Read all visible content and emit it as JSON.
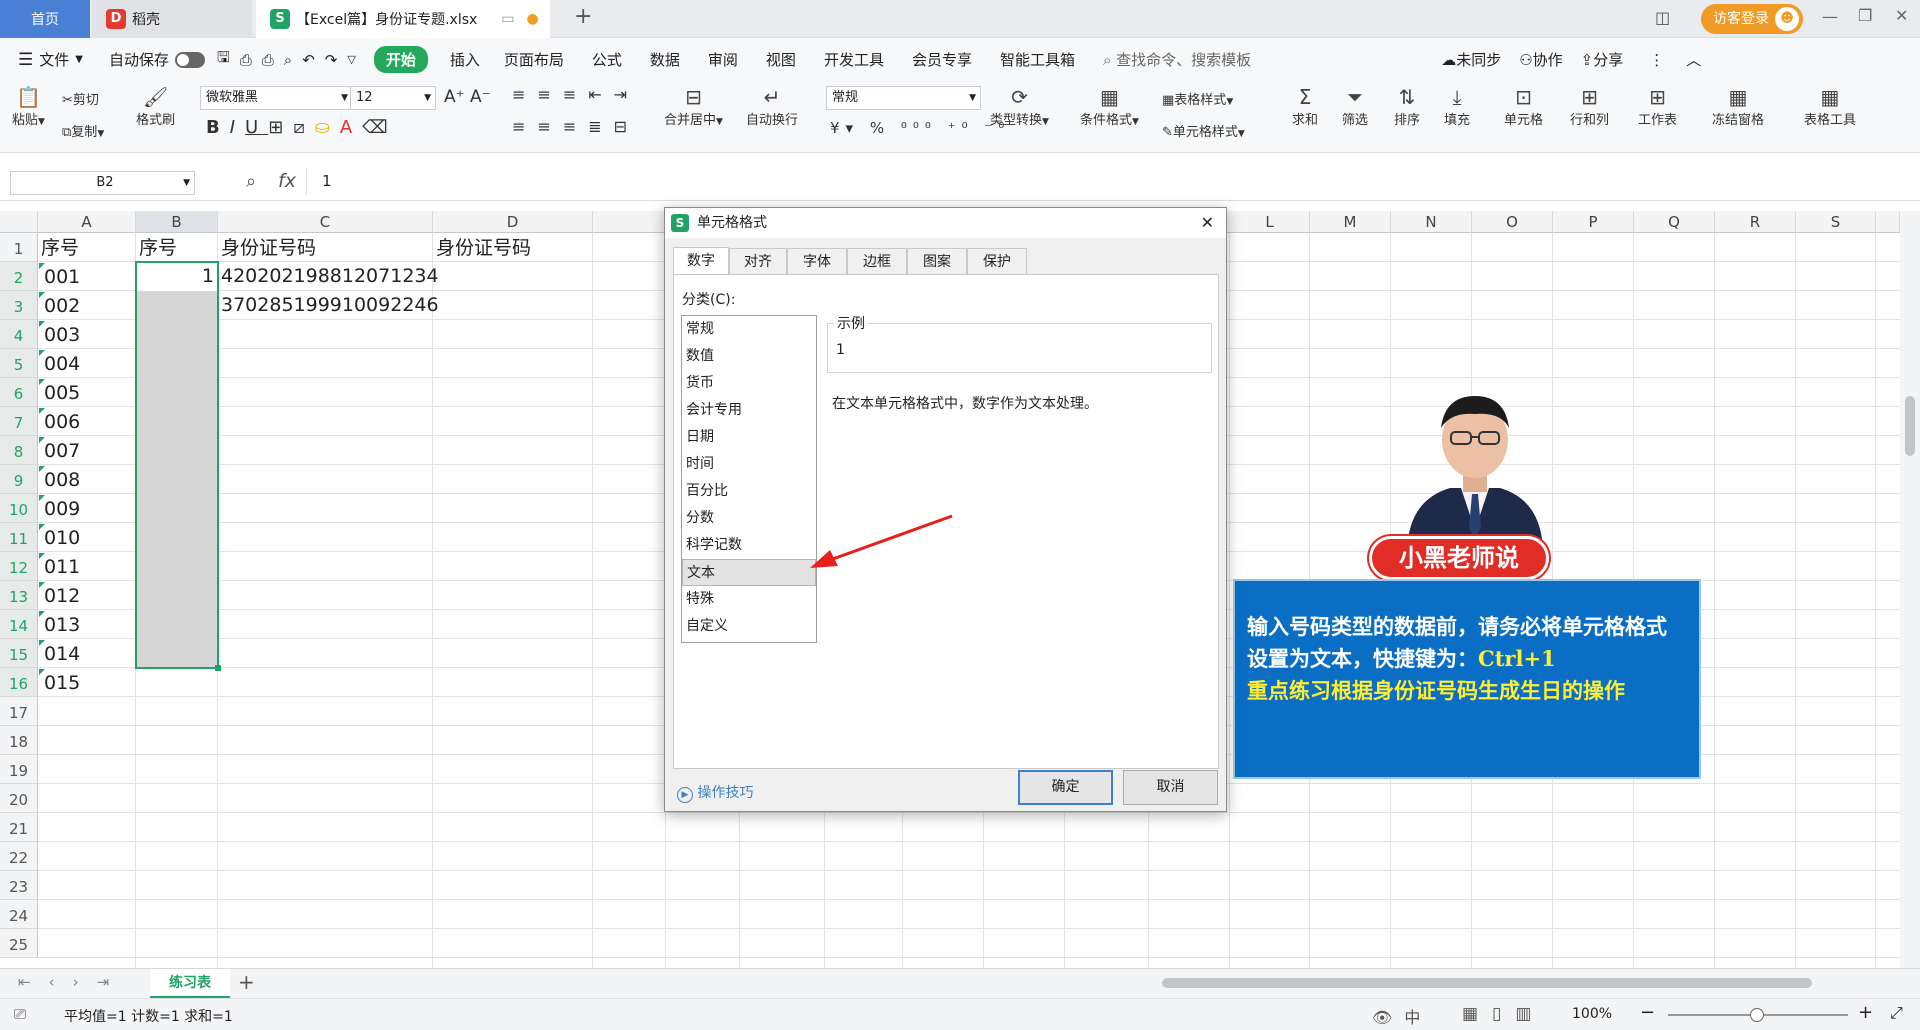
{
  "tabs": {
    "home": "首页",
    "doc": "稻壳",
    "file": "【Excel篇】身份证专题.xlsx",
    "new_tab": "+",
    "login": "访客登录"
  },
  "menu": {
    "file": "文件",
    "autosave": "自动保存",
    "items": [
      "开始",
      "插入",
      "页面布局",
      "公式",
      "数据",
      "审阅",
      "视图",
      "开发工具",
      "会员专享",
      "智能工具箱"
    ],
    "search": "查找命令、搜索模板",
    "unsynced": "未同步",
    "collab": "协作",
    "share": "分享"
  },
  "ribbon": {
    "paste": "粘贴",
    "cut": "剪切",
    "copy": "复制",
    "format_painter": "格式刷",
    "font_name": "微软雅黑",
    "font_size": "12",
    "merge_center": "合并居中",
    "wrap_text": "自动换行",
    "number_format": "常规",
    "type_convert": "类型转换",
    "cond_format": "条件格式",
    "table_style": "表格样式",
    "cell_style": "单元格样式",
    "sum": "求和",
    "filter": "筛选",
    "sort": "排序",
    "fill": "填充",
    "cell": "单元格",
    "row_col": "行和列",
    "worksheet": "工作表",
    "freeze": "冻结窗格",
    "table_tools": "表格工具"
  },
  "formula_bar": {
    "name_box": "B2",
    "fx": "fx",
    "value": "1"
  },
  "columns": [
    "A",
    "B",
    "C",
    "D",
    "L",
    "M",
    "N",
    "O",
    "P",
    "Q",
    "R",
    "S"
  ],
  "rows": [
    "1",
    "2",
    "3",
    "4",
    "5",
    "6",
    "7",
    "8",
    "9",
    "10",
    "11",
    "12",
    "13",
    "14",
    "15",
    "16",
    "17",
    "18",
    "19",
    "20",
    "21",
    "22",
    "23",
    "24",
    "25"
  ],
  "cells": {
    "A": [
      "序号",
      "001",
      "002",
      "003",
      "004",
      "005",
      "006",
      "007",
      "008",
      "009",
      "010",
      "011",
      "012",
      "013",
      "014",
      "015"
    ],
    "B1": "序号",
    "B2": "1",
    "C1": "身份证号码",
    "C2": "420202198812071234",
    "C3": "370285199910092246",
    "D1": "身份证号码"
  },
  "dialog": {
    "title": "单元格格式",
    "close": "✕",
    "tabs": [
      "数字",
      "对齐",
      "字体",
      "边框",
      "图案",
      "保护"
    ],
    "category_label": "分类(C):",
    "categories": [
      "常规",
      "数值",
      "货币",
      "会计专用",
      "日期",
      "时间",
      "百分比",
      "分数",
      "科学记数",
      "文本",
      "特殊",
      "自定义"
    ],
    "selected_category": "文本",
    "example_label": "示例",
    "example_value": "1",
    "description": "在文本单元格格式中，数字作为文本处理。",
    "tips": "操作技巧",
    "ok": "确定",
    "cancel": "取消"
  },
  "overlay": {
    "badge": "小黑老师说",
    "line1": "输入号码类型的数据前，请务必将单元格格式",
    "line2a": "设置为文本，快捷键为：",
    "line2b": "Ctrl+1",
    "line3": "重点练习根据身份证号码生成生日的操作"
  },
  "sheet": {
    "tab": "练习表",
    "add": "+"
  },
  "status": {
    "stats": "平均值=1  计数=1  求和=1",
    "zoom": "100%"
  },
  "colors": {
    "accent_green": "#23a85c",
    "selection_green": "#21a366",
    "banner_blue": "#0a6ec4",
    "badge_red": "#e02d25",
    "highlight_yellow": "#ffee33",
    "arrow_red": "#e8201c"
  }
}
